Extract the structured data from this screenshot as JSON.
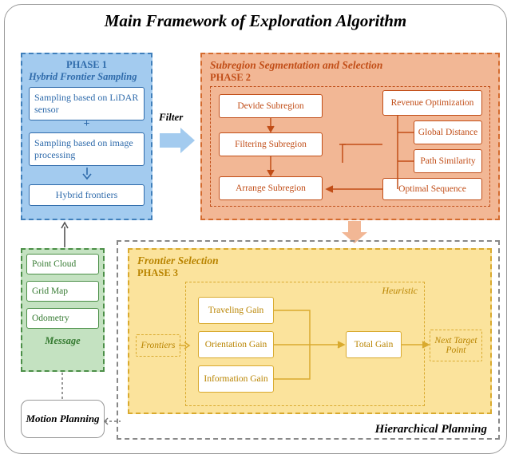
{
  "title": "Main Framework of Exploration Algorithm",
  "phase1": {
    "label": "PHASE 1",
    "subtitle": "Hybrid Frontier Sampling",
    "box1": "Sampling based on LiDAR sensor",
    "plus": "+",
    "box2": "Sampling based on image processing",
    "box3": "Hybrid frontiers"
  },
  "filter": "Filter",
  "phase2": {
    "subtitle": "Subregion Segmentation and Selection",
    "label": "PHASE 2",
    "divide": "Devide Subregion",
    "filtersr": "Filtering Subregion",
    "arrange": "Arrange Subregion",
    "revenue": "Revenue Optimization",
    "global": "Global Distance",
    "path": "Path Similarity",
    "optseq": "Optimal Sequence"
  },
  "message": {
    "pointcloud": "Point Cloud",
    "gridmap": "Grid Map",
    "odometry": "Odometry",
    "label": "Message"
  },
  "motion": "Motion Planning",
  "hierarchical": "Hierarchical Planning",
  "phase3": {
    "subtitle": "Frontier Selection",
    "label": "PHASE 3",
    "heuristic": "Heuristic",
    "frontiers": "Frontiers",
    "traveling": "Traveling Gain",
    "orientation": "Orientation Gain",
    "information": "Information Gain",
    "total": "Total Gain",
    "next": "Next Target Point"
  }
}
